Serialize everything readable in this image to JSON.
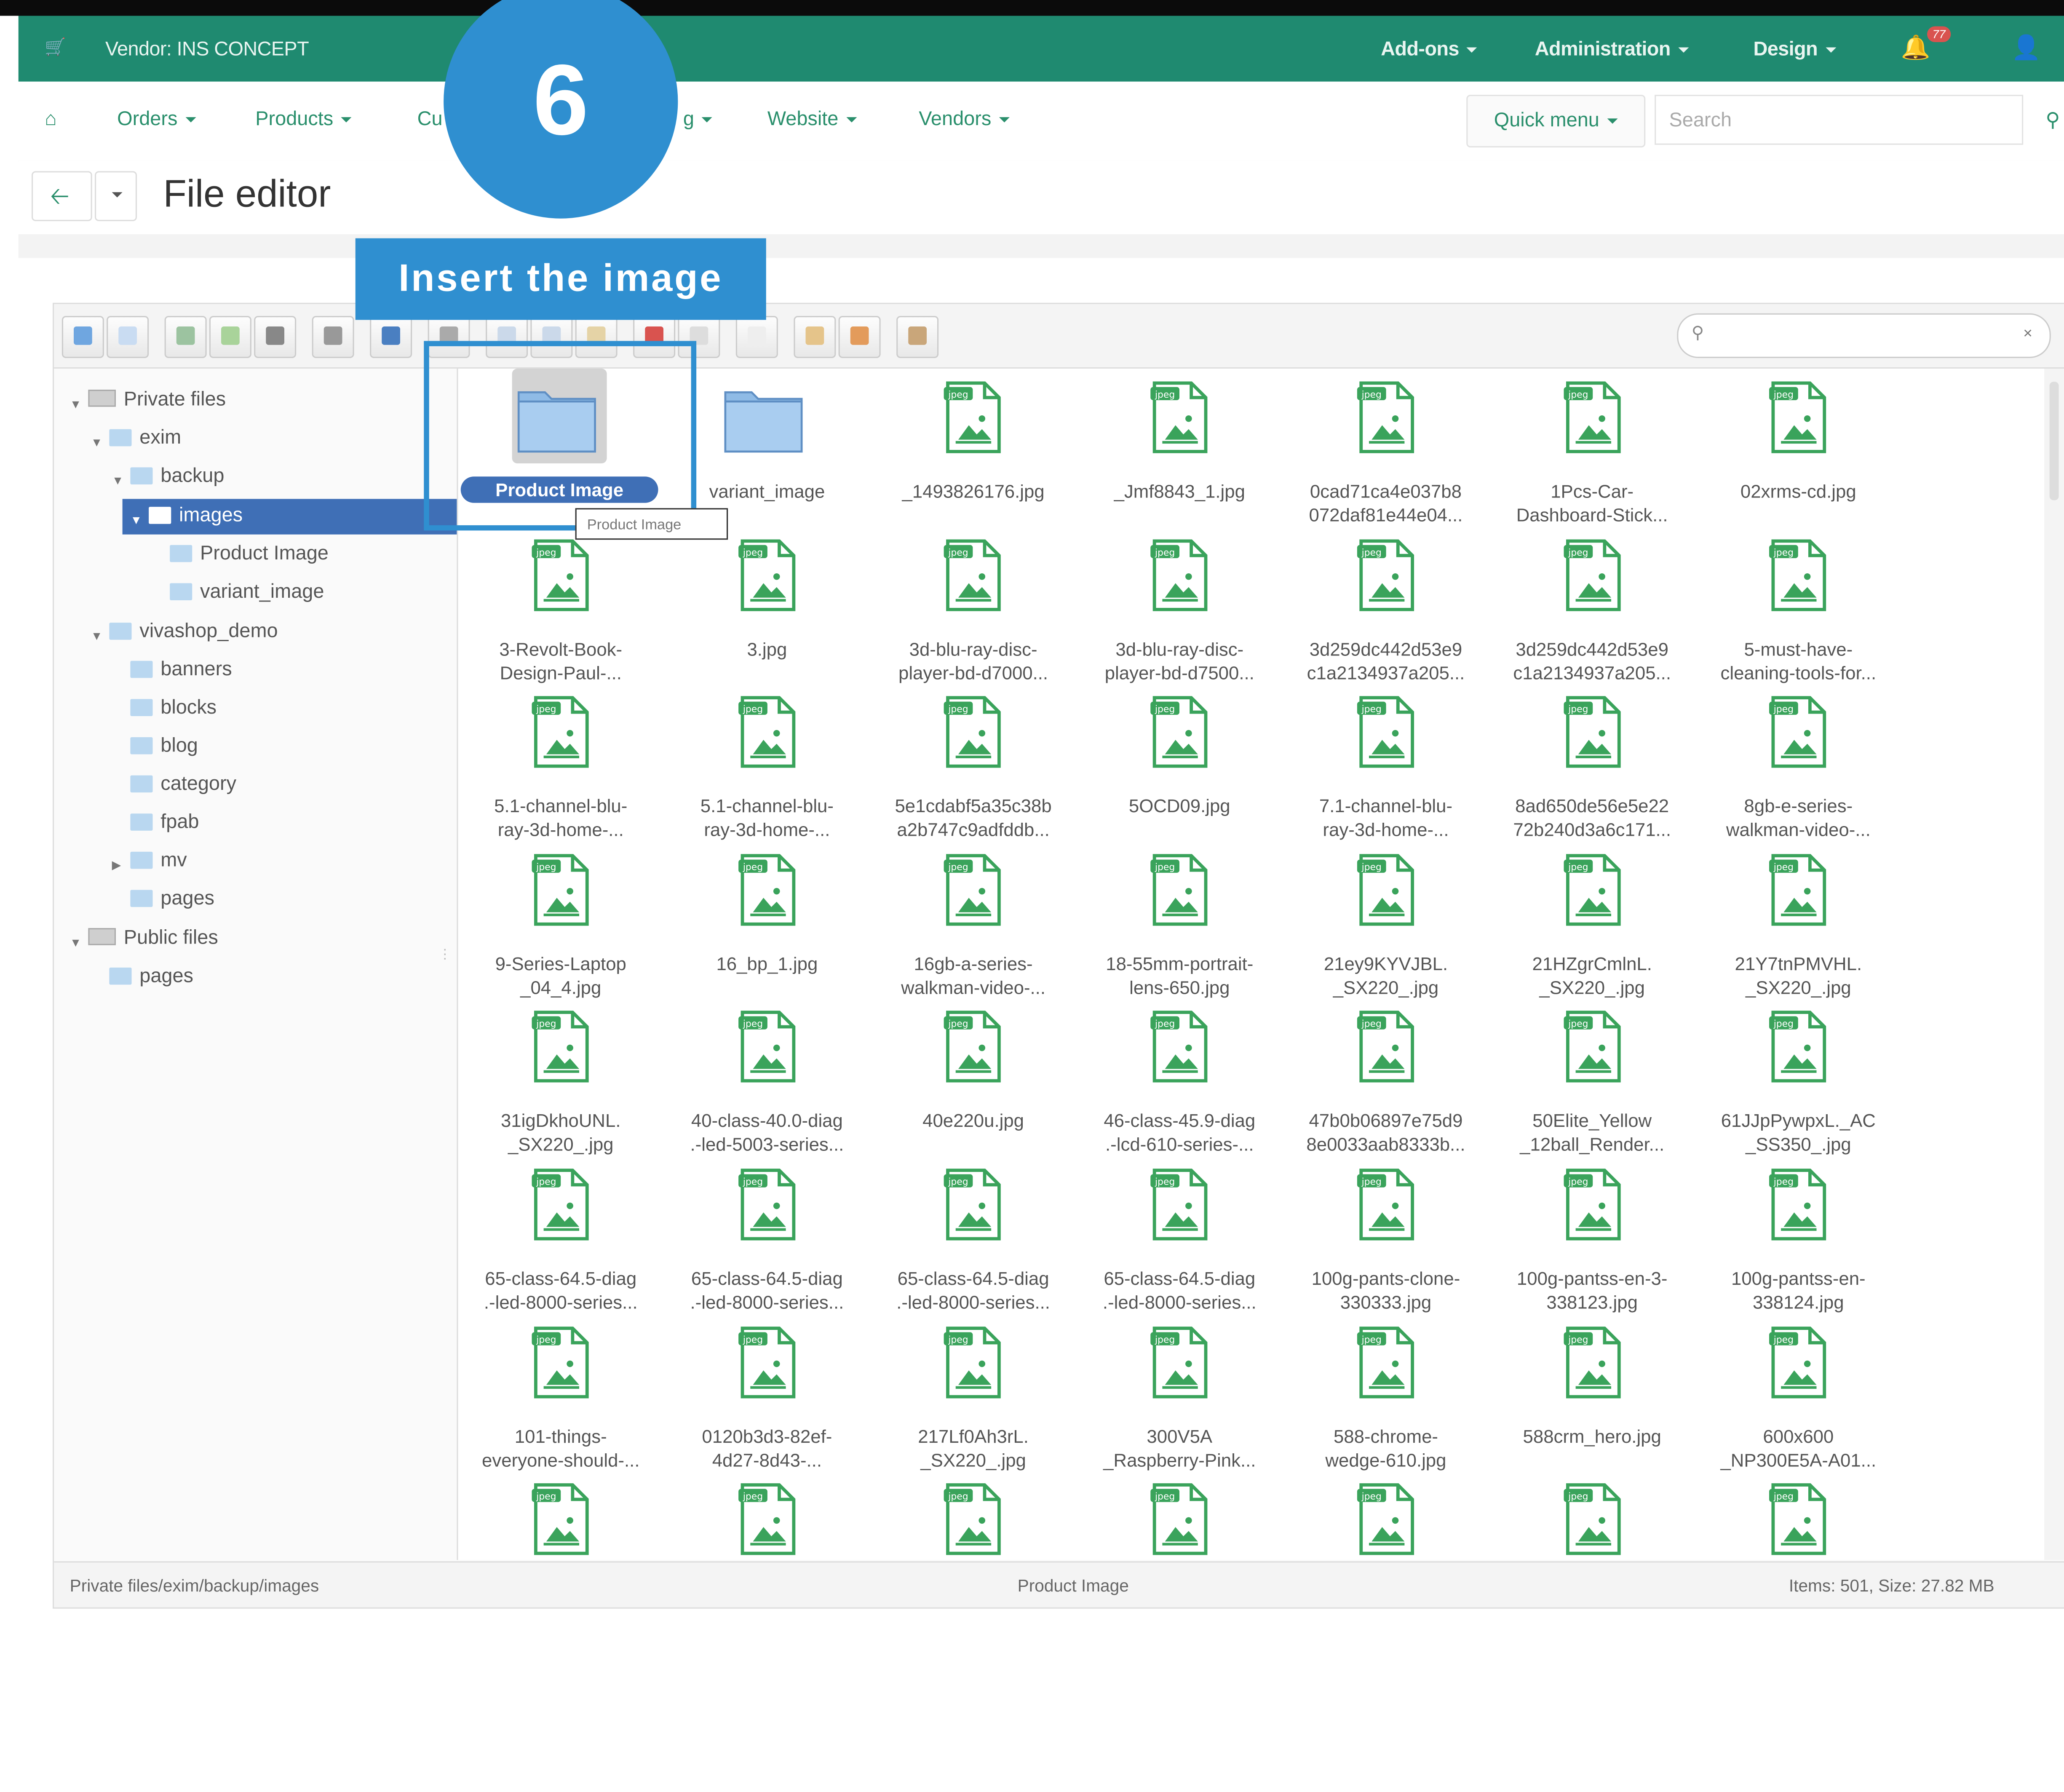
{
  "topbar": {
    "vendor": "Vendor: INS CONCEPT",
    "menus": [
      "Add-ons",
      "Administration",
      "Design"
    ],
    "notifications": "77"
  },
  "nav": {
    "items": [
      "Orders",
      "Products",
      "Cu",
      "g",
      "Website",
      "Vendors"
    ],
    "quick_menu": "Quick menu",
    "search_placeholder": "Search"
  },
  "page_title": "File editor",
  "overlay": {
    "step": "6",
    "label": "Insert the image"
  },
  "tree": [
    "Private files",
    "exim",
    "backup",
    "images",
    "Product Image",
    "variant_image",
    "vivashop_demo",
    "banners",
    "blocks",
    "blog",
    "category",
    "fpab",
    "mv",
    "pages",
    "Public files",
    "pages"
  ],
  "files": {
    "tooltip": "Product Image",
    "items": [
      {
        "name": "Product Image",
        "type": "folder"
      },
      {
        "name": "variant_image",
        "type": "folder"
      },
      {
        "name": "_1493826176.jpg",
        "type": "jpeg"
      },
      {
        "name": "_Jmf8843_1.jpg",
        "type": "jpeg"
      },
      {
        "name": "0cad71ca4e037b8\n072daf81e44e04...",
        "type": "jpeg"
      },
      {
        "name": "1Pcs-Car-\nDashboard-Stick...",
        "type": "jpeg"
      },
      {
        "name": "02xrms-cd.jpg",
        "type": "jpeg"
      },
      {
        "name": "3-Revolt-Book-\nDesign-Paul-...",
        "type": "jpeg"
      },
      {
        "name": "3.jpg",
        "type": "jpeg"
      },
      {
        "name": "3d-blu-ray-disc-\nplayer-bd-d7000...",
        "type": "jpeg"
      },
      {
        "name": "3d-blu-ray-disc-\nplayer-bd-d7500...",
        "type": "jpeg"
      },
      {
        "name": "3d259dc442d53e9\nc1a2134937a205...",
        "type": "jpeg"
      },
      {
        "name": "3d259dc442d53e9\nc1a2134937a205...",
        "type": "jpeg"
      },
      {
        "name": "5-must-have-\ncleaning-tools-for...",
        "type": "jpeg"
      },
      {
        "name": "5.1-channel-blu-\nray-3d-home-...",
        "type": "jpeg"
      },
      {
        "name": "5.1-channel-blu-\nray-3d-home-...",
        "type": "jpeg"
      },
      {
        "name": "5e1cdabf5a35c38b\na2b747c9adfddb...",
        "type": "jpeg"
      },
      {
        "name": "5OCD09.jpg",
        "type": "jpeg"
      },
      {
        "name": "7.1-channel-blu-\nray-3d-home-...",
        "type": "jpeg"
      },
      {
        "name": "8ad650de56e5e22\n72b240d3a6c171...",
        "type": "jpeg"
      },
      {
        "name": "8gb-e-series-\nwalkman-video-...",
        "type": "jpeg"
      },
      {
        "name": "9-Series-Laptop\n_04_4.jpg",
        "type": "jpeg"
      },
      {
        "name": "16_bp_1.jpg",
        "type": "jpeg"
      },
      {
        "name": "16gb-a-series-\nwalkman-video-...",
        "type": "jpeg"
      },
      {
        "name": "18-55mm-portrait-\nlens-650.jpg",
        "type": "jpeg"
      },
      {
        "name": "21ey9KYVJBL.\n_SX220_.jpg",
        "type": "jpeg"
      },
      {
        "name": "21HZgrCmlnL.\n_SX220_.jpg",
        "type": "jpeg"
      },
      {
        "name": "21Y7tnPMVHL.\n_SX220_.jpg",
        "type": "jpeg"
      },
      {
        "name": "31igDkhoUNL.\n_SX220_.jpg",
        "type": "jpeg"
      },
      {
        "name": "40-class-40.0-diag\n.-led-5003-series...",
        "type": "jpeg"
      },
      {
        "name": "40e220u.jpg",
        "type": "jpeg"
      },
      {
        "name": "46-class-45.9-diag\n.-lcd-610-series-...",
        "type": "jpeg"
      },
      {
        "name": "47b0b06897e75d9\n8e0033aab8333b...",
        "type": "jpeg"
      },
      {
        "name": "50Elite_Yellow\n_12ball_Render...",
        "type": "jpeg"
      },
      {
        "name": "61JJpPywpxL._AC\n_SS350_.jpg",
        "type": "jpeg"
      },
      {
        "name": "65-class-64.5-diag\n.-led-8000-series...",
        "type": "jpeg"
      },
      {
        "name": "65-class-64.5-diag\n.-led-8000-series...",
        "type": "jpeg"
      },
      {
        "name": "65-class-64.5-diag\n.-led-8000-series...",
        "type": "jpeg"
      },
      {
        "name": "65-class-64.5-diag\n.-led-8000-series...",
        "type": "jpeg"
      },
      {
        "name": "100g-pants-clone-\n330333.jpg",
        "type": "jpeg"
      },
      {
        "name": "100g-pantss-en-3-\n338123.jpg",
        "type": "jpeg"
      },
      {
        "name": "100g-pantss-en-\n338124.jpg",
        "type": "jpeg"
      },
      {
        "name": "101-things-\neveryone-should-...",
        "type": "jpeg"
      },
      {
        "name": "0120b3d3-82ef-\n4d27-8d43-...",
        "type": "jpeg"
      },
      {
        "name": "217Lf0Ah3rL.\n_SX220_.jpg",
        "type": "jpeg"
      },
      {
        "name": "300V5A\n_Raspberry-Pink...",
        "type": "jpeg"
      },
      {
        "name": "588-chrome-\nwedge-610.jpg",
        "type": "jpeg"
      },
      {
        "name": "588crm_hero.jpg",
        "type": "jpeg"
      },
      {
        "name": "600x600\n_NP300E5A-A01...",
        "type": "jpeg"
      },
      {
        "name": "",
        "type": "jpeg"
      },
      {
        "name": "",
        "type": "jpeg"
      },
      {
        "name": "",
        "type": "jpeg"
      },
      {
        "name": "",
        "type": "jpeg"
      },
      {
        "name": "",
        "type": "jpeg"
      },
      {
        "name": "",
        "type": "jpeg"
      },
      {
        "name": "",
        "type": "jpeg"
      }
    ]
  },
  "status": {
    "path": "Private files/exim/backup/images",
    "selected": "Product Image",
    "summary": "Items: 501, Size: 27.82 MB"
  },
  "colors": {
    "topbar": "#1f8a70",
    "accent": "#2f8fd0",
    "selection": "#3f6fb6",
    "jpeg_icon": "#3aa35b"
  }
}
